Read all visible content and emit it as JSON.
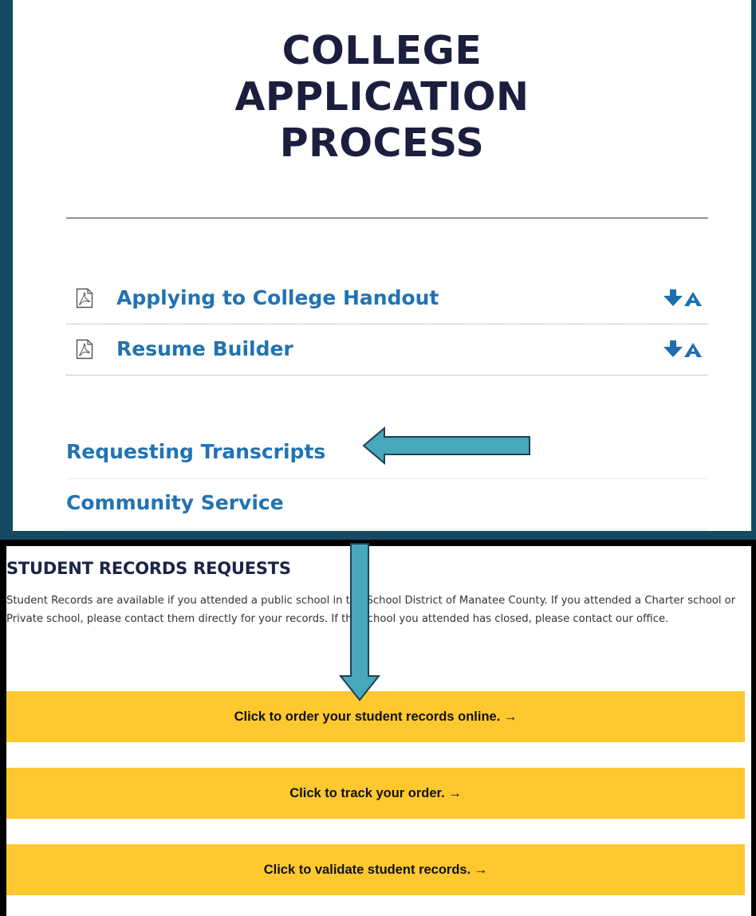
{
  "header": {
    "title_lines": [
      "COLLEGE",
      "APPLICATION",
      "PROCESS"
    ]
  },
  "documents": [
    {
      "label": "Applying to College Handout",
      "icon": "pdf-icon",
      "action_icon": "download-icon"
    },
    {
      "label": "Resume Builder",
      "icon": "pdf-icon",
      "action_icon": "download-icon"
    }
  ],
  "sections": [
    {
      "label": "Requesting Transcripts"
    },
    {
      "label": "Community Service"
    }
  ],
  "records": {
    "heading": "STUDENT RECORDS REQUESTS",
    "description": "Student Records are available if you attended a public school in the School District of Manatee County. If you attended a Charter school or Private school, please contact them directly for your records. If the school you attended has closed, please contact our office.",
    "buttons": [
      {
        "label": "Click to order your student records online. →"
      },
      {
        "label": "Click to track your order. →"
      },
      {
        "label": "Click to validate student records. →"
      }
    ]
  },
  "colors": {
    "background": "#164a62",
    "title": "#1b1e3d",
    "link": "#2173b2",
    "button": "#ffc82f",
    "annotation_arrow": "#46a8b8"
  }
}
